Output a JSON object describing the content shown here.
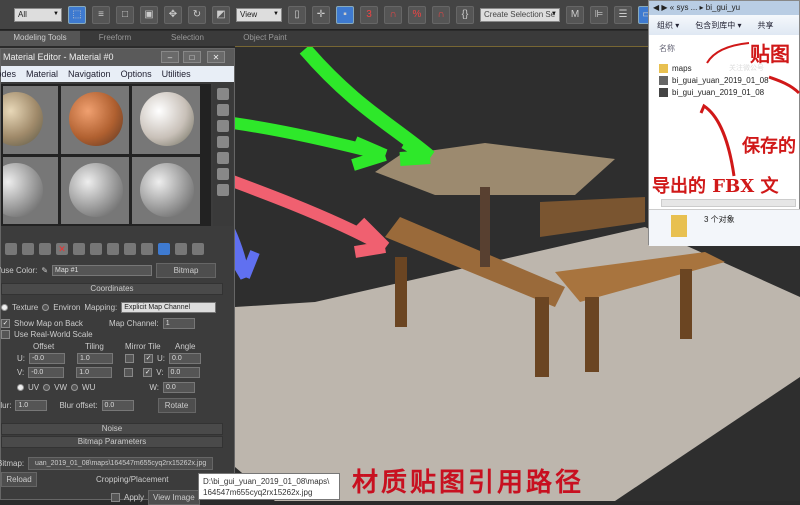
{
  "toolbar": {
    "filter_value": "All",
    "view_value": "View",
    "snap_label": "3",
    "selection_set_placeholder": "Create Selection Se"
  },
  "ribbon": {
    "tabs": [
      "Modeling Tools",
      "Freeform",
      "Selection",
      "Object Paint"
    ]
  },
  "material_editor": {
    "title": "Material Editor - Material #0",
    "menu": [
      "Modes",
      "Material",
      "Navigation",
      "Options",
      "Utilities"
    ],
    "diffuse_label": "Diffuse Color:",
    "map_name": "Map #1",
    "map_type": "Bitmap",
    "coordinates": {
      "header": "Coordinates",
      "texture": "Texture",
      "environ": "Environ",
      "mapping_label": "Mapping:",
      "mapping_value": "Explicit Map Channel",
      "show_map_on_back": "Show Map on Back",
      "map_channel_label": "Map Channel:",
      "map_channel_value": "1",
      "real_world": "Use Real-World Scale",
      "offset": "Offset",
      "tiling": "Tiling",
      "mirror_tile": "Mirror Tile",
      "angle": "Angle",
      "u": "U:",
      "v": "V:",
      "w": "W:",
      "offset_u": "-0.0",
      "offset_v": "-0.0",
      "tiling_u": "1.0",
      "tiling_v": "1.0",
      "angle_u": "0.0",
      "angle_v": "0.0",
      "angle_w": "0.0",
      "uv": "UV",
      "vw": "VW",
      "wu": "WU",
      "blur_label": "Blur:",
      "blur_value": "1.0",
      "blur_offset_label": "Blur offset:",
      "blur_offset_value": "0.0",
      "rotate": "Rotate"
    },
    "noise_header": "Noise",
    "bitmap_header": "Bitmap Parameters",
    "bitmap_label": "Bitmap:",
    "bitmap_path": "uan_2019_01_08\\maps\\164547m655cyq2rx15262x.jpg",
    "reload": "Reload",
    "cropping": "Cropping/Placement",
    "apply": "Apply",
    "view_image": "View Image"
  },
  "tooltip": {
    "line1": "D:\\bi_gui_yuan_2019_01_08\\maps\\",
    "line2": "164547m655cyq2rx15262x.jpg"
  },
  "explorer": {
    "breadcrumb": "« sys ... ▸ bi_gui_yu",
    "commands": [
      "组织 ▾",
      "包含到库中 ▾",
      "共享"
    ],
    "column_name": "名称",
    "files": [
      "maps",
      "bi_guai_yuan_2019_01_08",
      "bi_gui_yuan_2019_01_08"
    ],
    "status": "3 个对象",
    "watermark": "关注微公号"
  },
  "annotations": {
    "texture": "贴图",
    "saved": "保存的",
    "fbx": "导出的 FBX 文",
    "path": "材质贴图引用路径"
  },
  "colors": {
    "accent": "#3e7ad0",
    "annotation_red": "#d01818",
    "arrow_green": "#2ee82a",
    "arrow_pink": "#f06070",
    "arrow_blue": "#6070f0"
  }
}
